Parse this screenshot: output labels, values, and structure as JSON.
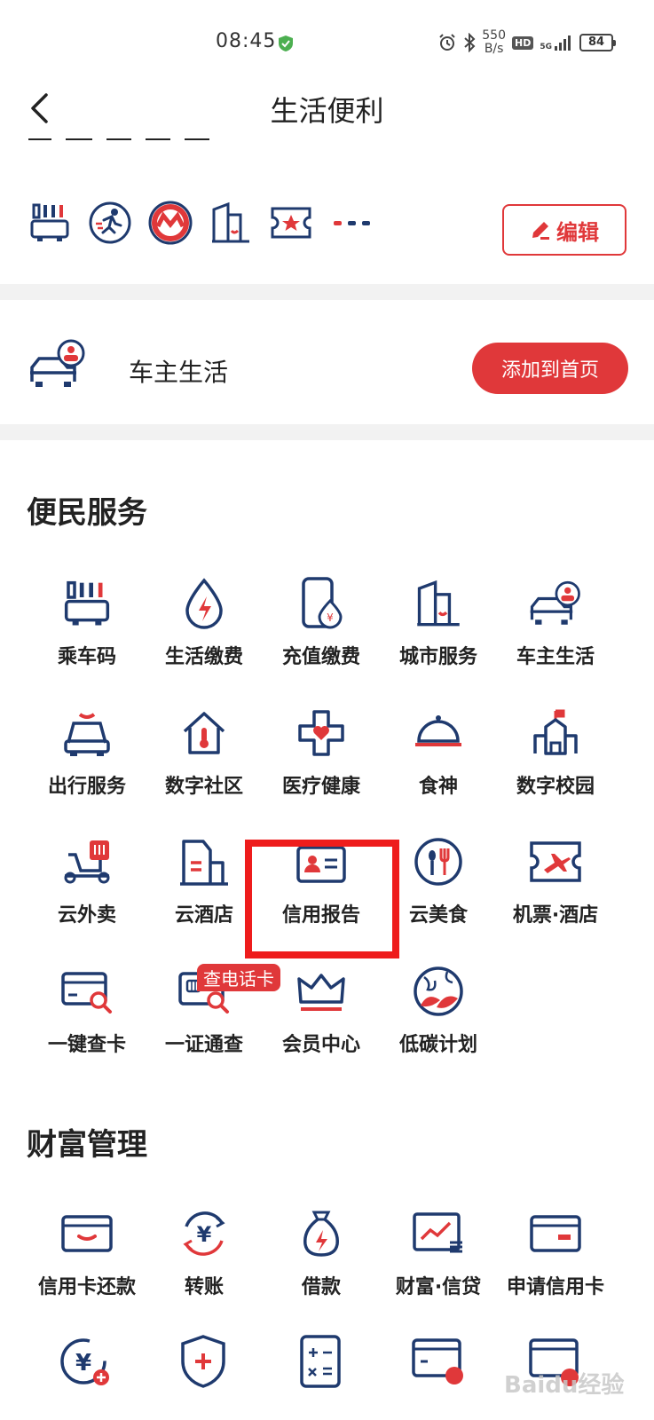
{
  "status_bar": {
    "time": "08:45",
    "net_speed_top": "550",
    "net_speed_bottom": "B/s",
    "hd": "HD",
    "network": "5G",
    "battery": "84"
  },
  "header": {
    "title": "生活便利"
  },
  "shortcuts": {
    "edit_label": "编辑"
  },
  "car_owner": {
    "label": "车主生活",
    "add_button": "添加到首页"
  },
  "sections": [
    {
      "title": "便民服务",
      "items": [
        {
          "label": "乘车码",
          "icon": "bus-card-icon"
        },
        {
          "label": "生活缴费",
          "icon": "drop-bolt-icon"
        },
        {
          "label": "充值缴费",
          "icon": "phone-yuan-icon"
        },
        {
          "label": "城市服务",
          "icon": "city-building-icon"
        },
        {
          "label": "车主生活",
          "icon": "car-owner-icon"
        },
        {
          "label": "出行服务",
          "icon": "taxi-icon"
        },
        {
          "label": "数字社区",
          "icon": "house-thermometer-icon"
        },
        {
          "label": "医疗健康",
          "icon": "medical-cross-icon"
        },
        {
          "label": "食神",
          "icon": "food-cloche-icon"
        },
        {
          "label": "数字校园",
          "icon": "school-icon"
        },
        {
          "label": "云外卖",
          "icon": "delivery-scooter-icon"
        },
        {
          "label": "云酒店",
          "icon": "hotel-icon"
        },
        {
          "label": "信用报告",
          "icon": "id-card-icon"
        },
        {
          "label": "云美食",
          "icon": "spoon-fork-icon"
        },
        {
          "label": "机票·酒店",
          "icon": "plane-ticket-icon"
        },
        {
          "label": "一键查卡",
          "icon": "card-search-icon"
        },
        {
          "label": "一证通查",
          "icon": "sim-search-icon"
        },
        {
          "label": "会员中心",
          "icon": "crown-icon"
        },
        {
          "label": "低碳计划",
          "icon": "globe-leaf-icon"
        }
      ],
      "badge": "查电话卡"
    },
    {
      "title": "财富管理",
      "items": [
        {
          "label": "信用卡还款",
          "icon": "card-repay-icon"
        },
        {
          "label": "转账",
          "icon": "transfer-yuan-icon"
        },
        {
          "label": "借款",
          "icon": "money-bag-icon"
        },
        {
          "label": "财富·信贷",
          "icon": "wealth-chart-icon"
        },
        {
          "label": "申请信用卡",
          "icon": "apply-card-icon"
        }
      ]
    }
  ],
  "watermark": "Baidu经验",
  "colors": {
    "navy": "#1f3a6e",
    "red": "#e0383a",
    "highlight": "#ee1c1c"
  }
}
